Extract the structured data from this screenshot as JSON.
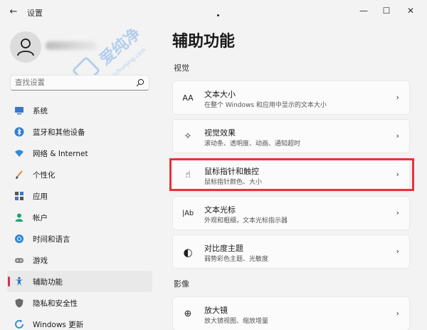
{
  "window": {
    "title": "设置",
    "back_glyph": "←",
    "minimize_glyph": "—",
    "maximize_glyph": "☐",
    "close_glyph": "✕"
  },
  "watermark": {
    "text_cn": "爱纯净",
    "text_url": "aichunjing.com"
  },
  "search": {
    "placeholder": "查找设置"
  },
  "sidebar": {
    "items": [
      {
        "label": "系统",
        "icon": "monitor-icon"
      },
      {
        "label": "蓝牙和其他设备",
        "icon": "bluetooth-icon"
      },
      {
        "label": "网络 & Internet",
        "icon": "wifi-icon"
      },
      {
        "label": "个性化",
        "icon": "brush-icon"
      },
      {
        "label": "应用",
        "icon": "apps-icon"
      },
      {
        "label": "帐户",
        "icon": "person-icon"
      },
      {
        "label": "时间和语言",
        "icon": "globe-clock-icon"
      },
      {
        "label": "游戏",
        "icon": "gamepad-icon"
      },
      {
        "label": "辅助功能",
        "icon": "accessibility-icon",
        "active": true
      },
      {
        "label": "隐私和安全性",
        "icon": "shield-icon"
      },
      {
        "label": "Windows 更新",
        "icon": "update-icon"
      }
    ]
  },
  "main": {
    "title": "辅助功能",
    "sections": [
      {
        "title": "视觉",
        "cards": [
          {
            "title": "文本大小",
            "subtitle": "在整个 Windows 和应用中显示的文本大小",
            "icon_glyph": "AA",
            "icon": "text-size-icon"
          },
          {
            "title": "视觉效果",
            "subtitle": "滚动条、透明度、动画、通知超时",
            "icon_glyph": "✧",
            "icon": "sparkle-icon"
          },
          {
            "title": "鼠标指针和触控",
            "subtitle": "鼠标指针颜色、大小",
            "icon_glyph": "☝",
            "icon": "pointer-icon",
            "highlighted": true
          },
          {
            "title": "文本光标",
            "subtitle": "外观和粗细，文本光标指示器",
            "icon_glyph": "|Ab",
            "icon": "text-cursor-icon"
          },
          {
            "title": "对比度主题",
            "subtitle": "弱势彩色主题、光敏度",
            "icon_glyph": "◐",
            "icon": "contrast-icon"
          }
        ]
      },
      {
        "title": "影像",
        "cards": [
          {
            "title": "放大镜",
            "subtitle": "放大镜视图、缩放增量",
            "icon_glyph": "⊕",
            "icon": "magnifier-icon"
          }
        ]
      }
    ],
    "chevron_glyph": "›"
  },
  "colors": {
    "accent": "#d1344e",
    "highlight_border": "#e8323c",
    "background": "#f3f3f3",
    "card": "#fbfbfb"
  }
}
